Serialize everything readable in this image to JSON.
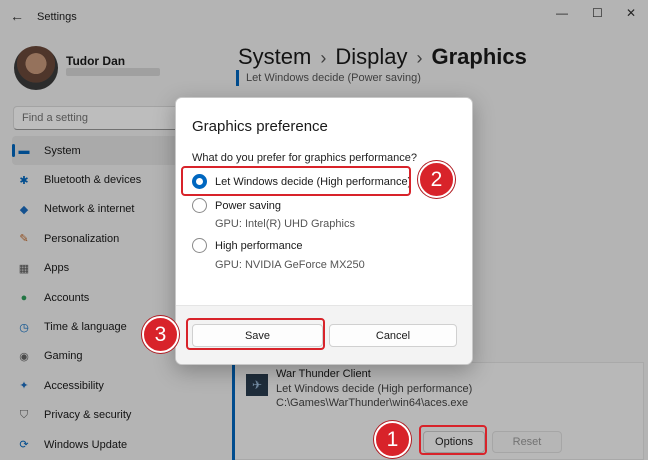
{
  "window": {
    "title": "Settings",
    "back_icon": "back-arrow-icon",
    "controls": {
      "minimize": "—",
      "maximize": "☐",
      "close": "✕"
    }
  },
  "user": {
    "name": "Tudor Dan"
  },
  "search": {
    "placeholder": "Find a setting"
  },
  "sidebar": {
    "items": [
      {
        "label": "System",
        "icon": "system-icon",
        "glyph": "▬",
        "color": "#0067c0",
        "active": true
      },
      {
        "label": "Bluetooth & devices",
        "icon": "bluetooth-icon",
        "glyph": "✱",
        "color": "#0067c0"
      },
      {
        "label": "Network & internet",
        "icon": "wifi-icon",
        "glyph": "◆",
        "color": "#1b6ec2"
      },
      {
        "label": "Personalization",
        "icon": "brush-icon",
        "glyph": "✎",
        "color": "#c46a2b"
      },
      {
        "label": "Apps",
        "icon": "apps-icon",
        "glyph": "▦",
        "color": "#555555"
      },
      {
        "label": "Accounts",
        "icon": "accounts-icon",
        "glyph": "●",
        "color": "#2e9e5b"
      },
      {
        "label": "Time & language",
        "icon": "clock-icon",
        "glyph": "◷",
        "color": "#0067c0"
      },
      {
        "label": "Gaming",
        "icon": "gamepad-icon",
        "glyph": "◉",
        "color": "#666666"
      },
      {
        "label": "Accessibility",
        "icon": "accessibility-icon",
        "glyph": "✦",
        "color": "#1b6ec2"
      },
      {
        "label": "Privacy & security",
        "icon": "shield-icon",
        "glyph": "⛉",
        "color": "#666666"
      },
      {
        "label": "Windows Update",
        "icon": "update-icon",
        "glyph": "⟳",
        "color": "#0067c0"
      }
    ]
  },
  "breadcrumb": {
    "part1": "System",
    "part2": "Display",
    "current": "Graphics",
    "separator": "›"
  },
  "top_setting_subtitle": "Let Windows decide (Power saving)",
  "app_card": {
    "name": "War Thunder Client",
    "preference": "Let Windows decide (High performance)",
    "path": "C:\\Games\\WarThunder\\win64\\aces.exe",
    "options_label": "Options",
    "reset_label": "Reset"
  },
  "dialog": {
    "title": "Graphics preference",
    "question": "What do you prefer for graphics performance?",
    "options": [
      {
        "label": "Let Windows decide (High performance)",
        "checked": true
      },
      {
        "label": "Power saving",
        "gpu": "GPU: Intel(R) UHD Graphics",
        "checked": false
      },
      {
        "label": "High performance",
        "gpu": "GPU: NVIDIA GeForce MX250",
        "checked": false
      }
    ],
    "save_label": "Save",
    "cancel_label": "Cancel"
  },
  "callouts": {
    "step1": "1",
    "step2": "2",
    "step3": "3",
    "color": "#d8232a"
  }
}
